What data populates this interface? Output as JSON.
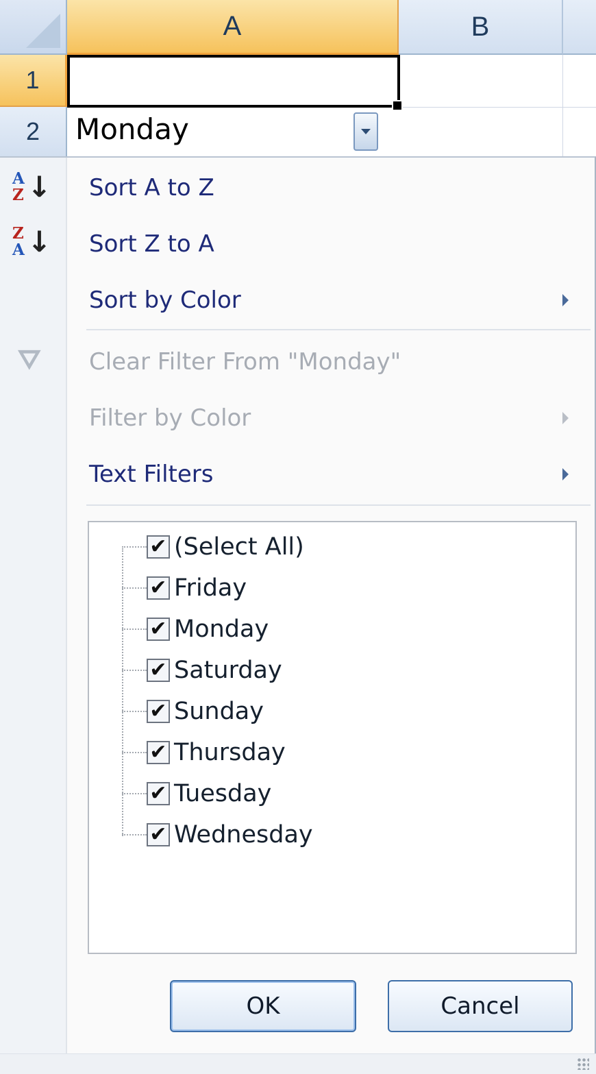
{
  "sheet": {
    "columns": [
      "A",
      "B"
    ],
    "rows": [
      "1",
      "2"
    ],
    "cells": {
      "A1": "",
      "A2": "Monday"
    }
  },
  "filter_menu": {
    "items": [
      {
        "label": "Sort A to Z",
        "enabled": true,
        "icon": "sort-a-to-z-icon"
      },
      {
        "label": "Sort Z to A",
        "enabled": true,
        "icon": "sort-z-to-a-icon"
      },
      {
        "label": "Sort by Color",
        "enabled": true,
        "submenu": true
      },
      {
        "label": "Clear Filter From \"Monday\"",
        "enabled": false,
        "icon": "clear-filter-icon"
      },
      {
        "label": "Filter by Color",
        "enabled": false,
        "submenu": true
      },
      {
        "label": "Text Filters",
        "enabled": true,
        "submenu": true
      }
    ],
    "icons": {
      "sort_asc_top": "A",
      "sort_asc_bottom": "Z",
      "sort_desc_top": "Z",
      "sort_desc_bottom": "A",
      "arrow": "↓",
      "funnel": "⛛"
    },
    "values_list": [
      {
        "label": "(Select All)",
        "checked": true
      },
      {
        "label": "Friday",
        "checked": true
      },
      {
        "label": "Monday",
        "checked": true
      },
      {
        "label": "Saturday",
        "checked": true
      },
      {
        "label": "Sunday",
        "checked": true
      },
      {
        "label": "Thursday",
        "checked": true
      },
      {
        "label": "Tuesday",
        "checked": true
      },
      {
        "label": "Wednesday",
        "checked": true
      }
    ],
    "check_glyph": "✔",
    "buttons": {
      "ok": "OK",
      "cancel": "Cancel"
    }
  },
  "colors": {
    "active_header": "#f6c25c",
    "header": "#d2dff0",
    "menu_text": "#1e2a78",
    "disabled_text": "#a7acb4",
    "button_border": "#3d6ea8"
  }
}
